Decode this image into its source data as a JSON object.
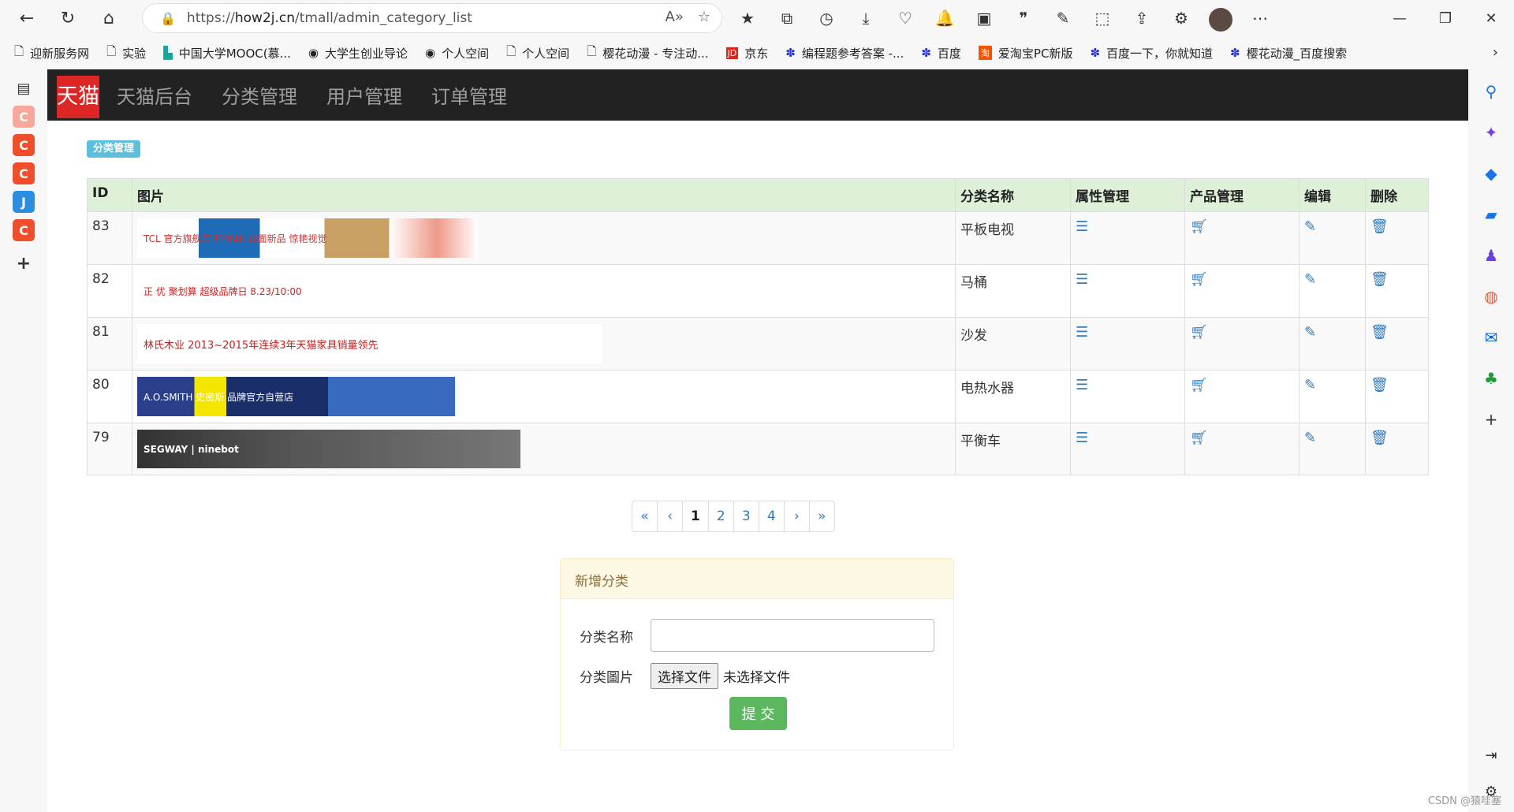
{
  "browser": {
    "url_prefix": "https://",
    "url_host": "how2j.cn",
    "url_path": "/tmall/admin_category_list",
    "bookmarks": [
      "迎新服务网",
      "实验",
      "中国大学MOOC(慕...",
      "大学生创业导论",
      "个人空间",
      "个人空间",
      "樱花动漫 - 专注动...",
      "京东",
      "编程题参考答案 -...",
      "百度",
      "爱淘宝PC新版",
      "百度一下，你就知道",
      "樱花动漫_百度搜索"
    ]
  },
  "nav": {
    "logo": "天猫",
    "links": [
      "天猫后台",
      "分类管理",
      "用户管理",
      "订单管理"
    ]
  },
  "tag": "分类管理",
  "table": {
    "headers": [
      "ID",
      "图片",
      "分类名称",
      "属性管理",
      "产品管理",
      "编辑",
      "删除"
    ],
    "rows": [
      {
        "id": "83",
        "name": "平板电视",
        "banner_text": "TCL 官方旗舰店 轻薄4K 曲面新品 惊艳视觉"
      },
      {
        "id": "82",
        "name": "马桶",
        "banner_text": "正 优 聚划算 超级品牌日 8.23/10:00"
      },
      {
        "id": "81",
        "name": "沙发",
        "banner_text": "林氏木业 2013~2015年连续3年天猫家具销量领先"
      },
      {
        "id": "80",
        "name": "电热水器",
        "banner_text": "A.O.SMITH 史密斯 品牌官方自营店"
      },
      {
        "id": "79",
        "name": "平衡车",
        "banner_text": "SEGWAY | ninebot"
      }
    ]
  },
  "pagination": [
    "«",
    "‹",
    "1",
    "2",
    "3",
    "4",
    "›",
    "»"
  ],
  "form": {
    "title": "新增分类",
    "name_label": "分类名称",
    "image_label": "分类圖片",
    "file_button": "选择文件",
    "file_status": "未选择文件",
    "submit": "提 交"
  },
  "watermark": "CSDN @猿哇塞"
}
